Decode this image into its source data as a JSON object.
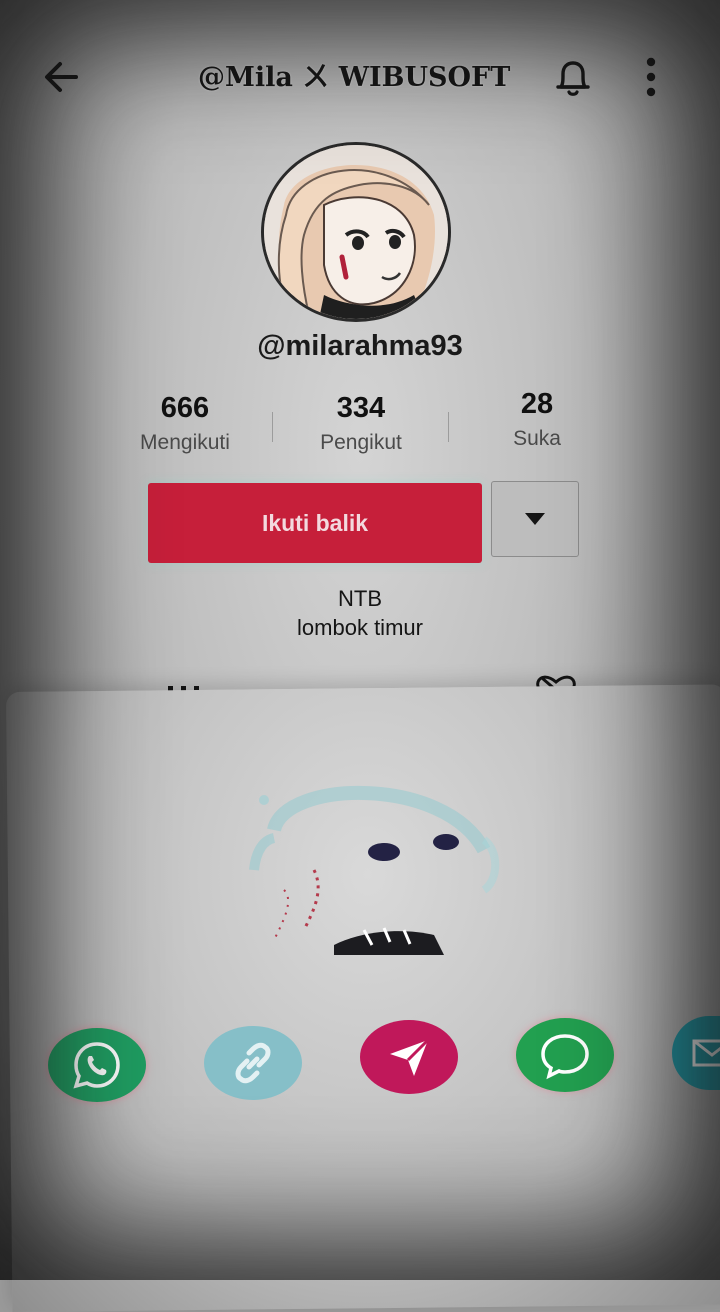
{
  "header": {
    "title": "@Mila ㄨ WIBUSOFT",
    "back_icon": "arrow-left-icon",
    "bell_icon": "bell-icon",
    "more_icon": "more-vertical-icon"
  },
  "profile": {
    "username": "@milarahma93",
    "stats": [
      {
        "value": "666",
        "label": "Mengikuti"
      },
      {
        "value": "334",
        "label": "Pengikut"
      },
      {
        "value": "28",
        "label": "Suka"
      }
    ],
    "follow_button": "Ikuti balik",
    "bio_line1": "NTB",
    "bio_line2": "lombok timur"
  },
  "share_sheet": {
    "buttons": [
      {
        "name": "whatsapp",
        "icon": "whatsapp-icon",
        "color": "#1f9e62"
      },
      {
        "name": "copy-link",
        "icon": "link-icon",
        "color": "#86bfc8"
      },
      {
        "name": "direct-message",
        "icon": "send-icon",
        "color": "#c0185a"
      },
      {
        "name": "sms",
        "icon": "chat-bubble-icon",
        "color": "#22a050"
      },
      {
        "name": "email",
        "icon": "mail-icon",
        "color": "#1f9aa8"
      }
    ]
  },
  "colors": {
    "accent": "#c61f3a",
    "background": "#bdbdbd"
  }
}
